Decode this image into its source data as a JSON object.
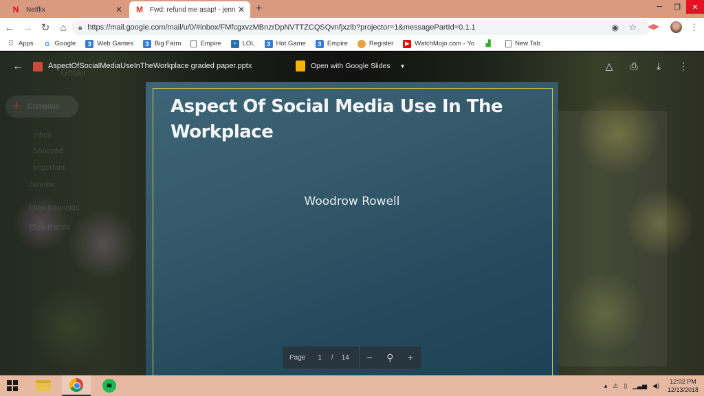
{
  "browser": {
    "tabs": [
      {
        "title": "Netflix",
        "favicon": "netflix-icon",
        "active": false
      },
      {
        "title": "Fwd: refund me asap! - jennifer.h",
        "favicon": "gmail-icon",
        "active": true
      }
    ],
    "url": "https://mail.google.com/mail/u/0/#inbox/FMfcgxvzMBnzrDpNVTTZCQSQvnfjxzlb?projector=1&messagePartId=0.1.1",
    "bookmarks": [
      {
        "label": "Apps",
        "icon": "apps-grid-icon"
      },
      {
        "label": "Google",
        "icon": "google-icon"
      },
      {
        "label": "Web Games",
        "icon": "bookmark-3-icon"
      },
      {
        "label": "Big Farm",
        "icon": "bookmark-3-icon"
      },
      {
        "label": "Empire",
        "icon": "page-icon"
      },
      {
        "label": "LOL",
        "icon": "lol-icon"
      },
      {
        "label": "Hot Game",
        "icon": "bookmark-3-icon"
      },
      {
        "label": "Empire",
        "icon": "bookmark-3-icon"
      },
      {
        "label": "Register",
        "icon": "register-icon"
      },
      {
        "label": "WatchMojo.com - Yo",
        "icon": "youtube-icon"
      },
      {
        "label": "",
        "icon": "green-icon"
      },
      {
        "label": "New Tab",
        "icon": "page-icon"
      }
    ]
  },
  "viewer": {
    "filename": "AspectOfSocialMediaUseInTheWorkplace graded paper.pptx",
    "open_with": "Open with Google Slides"
  },
  "gmail_background": {
    "brand": "Gmail",
    "compose": "Compose",
    "nav": [
      "Inbox",
      "Snoozed",
      "Important",
      "Jennifer",
      "Ellen Reynolds",
      "Eliza Barrett"
    ]
  },
  "slide": {
    "title": "Aspect Of Social Media Use In The Workplace",
    "author": "Woodrow Rowell"
  },
  "pager": {
    "label": "Page",
    "current": "1",
    "separator": "/",
    "total": "14"
  },
  "taskbar": {
    "time": "12:02 PM",
    "date": "12/13/2018"
  },
  "colors": {
    "tab_strip": "#d99a80",
    "taskbar": "#e7b9a3",
    "slide_bg": "#2f5669",
    "slide_border": "#d4c84a"
  }
}
